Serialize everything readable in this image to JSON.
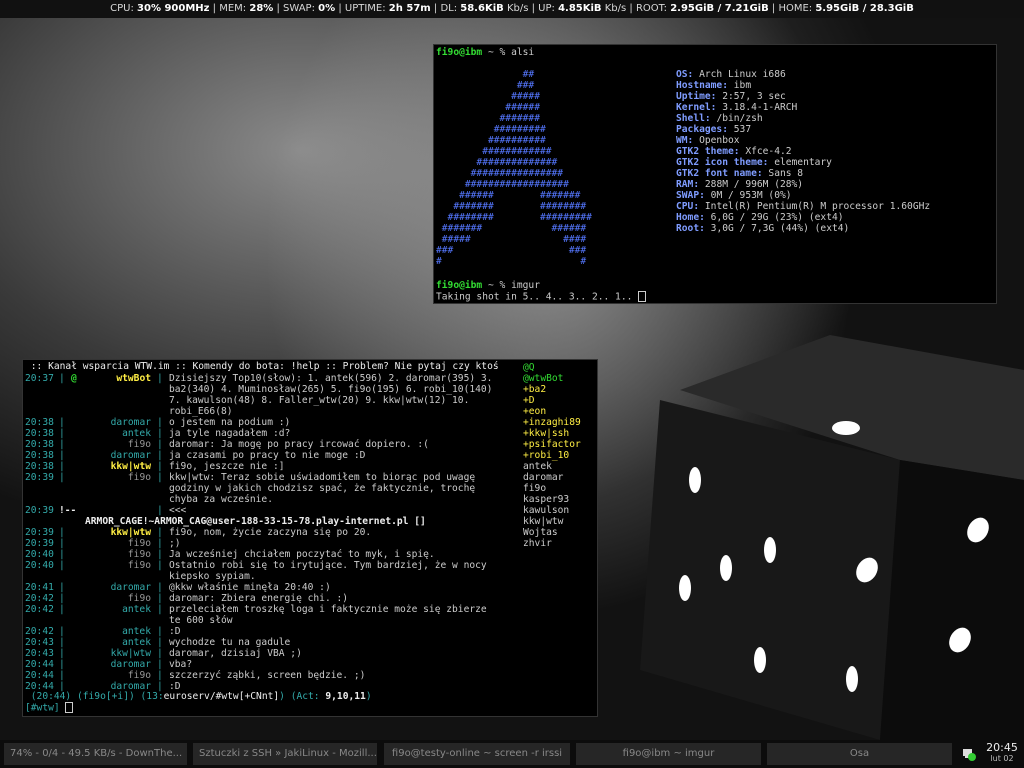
{
  "statusbar": {
    "cpu_label": "CPU:",
    "cpu_value": "30% 900MHz",
    "mem_label": "MEM:",
    "mem_value": "28%",
    "swap_label": "SWAP:",
    "swap_value": "0%",
    "uptime_label": "UPTIME:",
    "uptime_value": "2h 57m",
    "dl_label": "DL:",
    "dl_value": "58.6KiB",
    "dl_unit": "Kb/s",
    "up_label": "UP:",
    "up_value": "4.85KiB",
    "up_unit": "Kb/s",
    "root_label": "ROOT:",
    "root_value": "2.95GiB / 7.21GiB",
    "home_label": "HOME:",
    "home_value": "5.95GiB / 28.3GiB"
  },
  "alsi": {
    "prompt_user": "fi9o@ibm",
    "prompt_rest": " ~ % ",
    "cmd1": "alsi",
    "logo": [
      "               ##",
      "              ###",
      "             #####",
      "            ######",
      "           #######",
      "          #########",
      "         ##########",
      "        ############",
      "       ##############",
      "      ################",
      "     ##################",
      "    ######        #######",
      "   #######        ########",
      "  ########        #########",
      " #######            ######",
      " #####                ####",
      "###                    ###",
      "#                        #"
    ],
    "info": [
      {
        "k": "OS:",
        "v": "Arch Linux i686"
      },
      {
        "k": "Hostname:",
        "v": "ibm"
      },
      {
        "k": "Uptime:",
        "v": "2:57, 3 sec"
      },
      {
        "k": "Kernel:",
        "v": "3.18.4-1-ARCH"
      },
      {
        "k": "Shell:",
        "v": "/bin/zsh"
      },
      {
        "k": "Packages:",
        "v": "537"
      },
      {
        "k": "WM:",
        "v": "Openbox"
      },
      {
        "k": "GTK2 theme:",
        "v": "Xfce-4.2"
      },
      {
        "k": "GTK2 icon theme:",
        "v": "elementary"
      },
      {
        "k": "GTK2 font name:",
        "v": "Sans 8"
      },
      {
        "k": "RAM:",
        "v": "288M / 996M (28%)"
      },
      {
        "k": "SWAP:",
        "v": "0M / 953M (0%)"
      },
      {
        "k": "CPU:",
        "v": "Intel(R) Pentium(R) M processor 1.60GHz"
      },
      {
        "k": "Home:",
        "v": "6,0G / 29G (23%) (ext4)"
      },
      {
        "k": "Root:",
        "v": "3,0G / 7,3G (44%) (ext4)"
      }
    ],
    "cmd2": "imgur",
    "output": "Taking shot in 5.. 4.. 3.. 2.. 1.. "
  },
  "irssi": {
    "topic": " :: Kanał wsparcia WTW.im :: Komendy do bota: !help :: Problem? Nie pytaj czy ktoś",
    "lines": [
      {
        "t": "20:37",
        "m": "@",
        "n": "wtwBot",
        "nc": "yellow",
        "x": "Dzisiejszy Top10(słow): 1. antek(596) 2. daromar(395) 3."
      },
      {
        "t": "",
        "m": "",
        "n": "",
        "nc": "",
        "x": "ba2(340) 4. Muminosław(265) 5. fi9o(195) 6. robi_10(140)"
      },
      {
        "t": "",
        "m": "",
        "n": "",
        "nc": "",
        "x": "7. kawulson(48) 8. Faller_wtw(20) 9. kkw|wtw(12) 10."
      },
      {
        "t": "",
        "m": "",
        "n": "",
        "nc": "",
        "x": "robi_E66(8)"
      },
      {
        "t": "20:38",
        "m": "",
        "n": "daromar",
        "nc": "cyan",
        "x": "o jestem na podium :)"
      },
      {
        "t": "20:38",
        "m": "",
        "n": "antek",
        "nc": "cyan",
        "x": "ja tyle nagadałem :d?"
      },
      {
        "t": "20:38",
        "m": "",
        "n": "fi9o",
        "nc": "dim",
        "x": "daromar: Ja mogę po pracy ircować dopiero. :("
      },
      {
        "t": "20:38",
        "m": "",
        "n": "daromar",
        "nc": "cyan",
        "x": "ja czasami po pracy to nie moge :D"
      },
      {
        "t": "20:38",
        "m": "",
        "n": "kkw|wtw",
        "nc": "yellow",
        "x": "fi9o, jeszcze nie :]"
      },
      {
        "t": "20:39",
        "m": "",
        "n": "fi9o",
        "nc": "dim",
        "x": "kkw|wtw: Teraz sobie uświadomiłem to biorąc pod uwagę"
      },
      {
        "t": "",
        "m": "",
        "n": "",
        "nc": "",
        "x": "godziny w jakich chodzisz spać, że faktycznie, trochę"
      },
      {
        "t": "",
        "m": "",
        "n": "",
        "nc": "",
        "x": "chyba za wcześnie."
      },
      {
        "t": "20:39",
        "m": "!--",
        "n": "",
        "nc": "",
        "x": "<<<"
      },
      {
        "t": "",
        "m": "",
        "n": "",
        "nc": "",
        "x": "ARMOR_CAGE!~ARMOR_CAG@user-188-33-15-78.play-internet.pl []",
        "special": "join"
      },
      {
        "t": "20:39",
        "m": "",
        "n": "kkw|wtw",
        "nc": "yellow",
        "x": "fi9o, nom, życie zaczyna się po 20."
      },
      {
        "t": "20:39",
        "m": "",
        "n": "fi9o",
        "nc": "dim",
        "x": ";)"
      },
      {
        "t": "20:40",
        "m": "",
        "n": "fi9o",
        "nc": "dim",
        "x": "Ja wcześniej chciałem poczytać to myk, i spię."
      },
      {
        "t": "20:40",
        "m": "",
        "n": "fi9o",
        "nc": "dim",
        "x": "Ostatnio robi się to irytujące. Tym bardziej, że w nocy"
      },
      {
        "t": "",
        "m": "",
        "n": "",
        "nc": "",
        "x": "kiepsko sypiam."
      },
      {
        "t": "20:41",
        "m": "",
        "n": "daromar",
        "nc": "cyan",
        "x": "@kkw właśnie minęła 20:40 :)"
      },
      {
        "t": "20:42",
        "m": "",
        "n": "fi9o",
        "nc": "dim",
        "x": "daromar: Zbiera energię chi. :)"
      },
      {
        "t": "20:42",
        "m": "",
        "n": "antek",
        "nc": "cyan",
        "x": "przeleciałem troszkę loga i faktycznie może się zbierze"
      },
      {
        "t": "",
        "m": "",
        "n": "",
        "nc": "",
        "x": "te 600 słów"
      },
      {
        "t": "20:42",
        "m": "",
        "n": "antek",
        "nc": "cyan",
        "x": ":D"
      },
      {
        "t": "20:43",
        "m": "",
        "n": "antek",
        "nc": "cyan",
        "x": "wychodze tu na gadule"
      },
      {
        "t": "20:43",
        "m": "",
        "n": "kkw|wtw",
        "nc": "cyan",
        "x": "daromar, dzisiaj VBA ;)"
      },
      {
        "t": "20:44",
        "m": "",
        "n": "daromar",
        "nc": "cyan",
        "x": "vba?"
      },
      {
        "t": "20:44",
        "m": "",
        "n": "fi9o",
        "nc": "dim",
        "x": "szczerzyć ząbki, screen będzie. ;)"
      },
      {
        "t": "20:44",
        "m": "",
        "n": "daromar",
        "nc": "cyan",
        "x": ":D"
      }
    ],
    "nicklist": [
      "@Q",
      "@wtwBot",
      "+ba2",
      "+D",
      "+eon",
      "+inzaghi89",
      "+kkw|ssh",
      "+psifactor",
      "+robi_10",
      "antek",
      "daromar",
      "fi9o",
      "kasper93",
      "kawulson",
      "kkw|wtw",
      "Wojtas",
      "zhvir"
    ],
    "statusline_pre": " (20:44) (fi9o[+i]) (13:",
    "statusline_chan": "euroserv/#wtw[+CNnt]",
    "statusline_act_label": ") (Act: ",
    "statusline_act": "9,10,11",
    "statusline_end": ")",
    "input_prompt": "[#wtw] "
  },
  "taskbar": {
    "tasks": [
      "74% - 0/4 - 49.5 KB/s - DownThe...",
      "Sztuczki z SSH » JakiLinux - Mozill...",
      "fi9o@testy-online ~ screen -r irssi",
      "fi9o@ibm ~ imgur",
      "Osa"
    ],
    "clock_time": "20:45",
    "clock_date": "lut 02",
    "tray_icon": "network-icon"
  },
  "colors": {
    "accent_green": "#33dd33",
    "accent_blue": "#7f9cff",
    "nick_cyan": "#33aaaa",
    "nick_yellow": "#ffee44"
  }
}
